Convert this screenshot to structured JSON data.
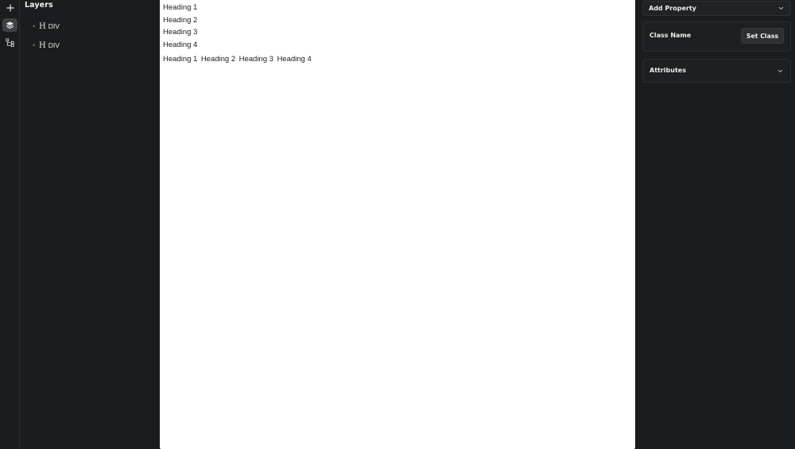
{
  "rail": {
    "items": [
      {
        "name": "add",
        "icon": "plus-icon",
        "active": false
      },
      {
        "name": "layers",
        "icon": "layers-icon",
        "active": true
      },
      {
        "name": "components",
        "icon": "tree-icon",
        "active": false
      }
    ]
  },
  "layers_panel": {
    "title": "Layers",
    "items": [
      {
        "glyph": "H",
        "label": "DIV"
      },
      {
        "glyph": "H",
        "label": "DIV"
      }
    ]
  },
  "canvas": {
    "headings": [
      "Heading 1",
      "Heading 2",
      "Heading 3",
      "Heading 4"
    ],
    "inline_headings": [
      "Heading 1",
      "Heading 2",
      "Heading 3",
      "Heading 4"
    ]
  },
  "properties": {
    "add_property_label": "Add Property",
    "class_name_label": "Class Name",
    "set_class_label": "Set Class",
    "attributes_label": "Attributes"
  },
  "colors": {
    "panel_bg": "#1a1d1d",
    "canvas_bg": "#ffffff",
    "active_rail": "#3c4242"
  }
}
